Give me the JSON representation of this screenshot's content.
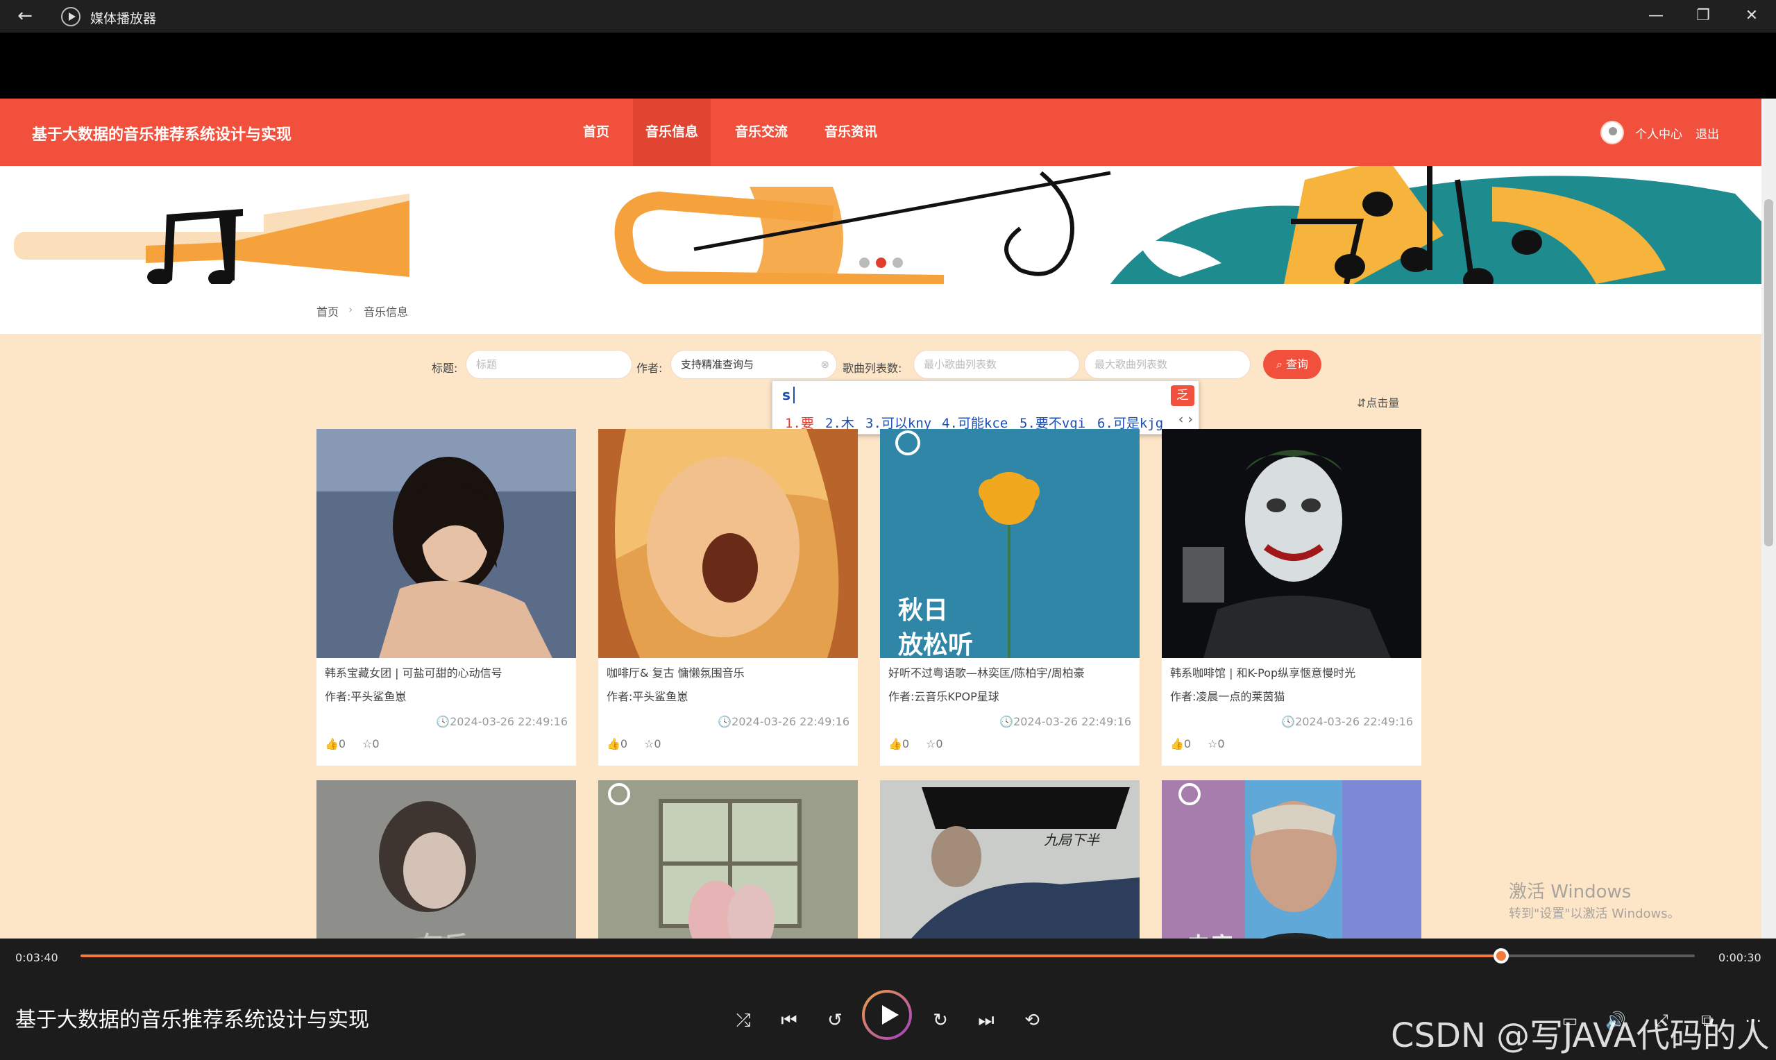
{
  "window": {
    "title": "媒体播放器",
    "back_icon": "←",
    "minimize_icon": "—",
    "restore_icon": "❐",
    "close_icon": "✕"
  },
  "site": {
    "brand": "基于大数据的音乐推荐系统设计与实现",
    "nav": [
      "首页",
      "音乐信息",
      "音乐交流",
      "音乐资讯"
    ],
    "active_nav": "音乐信息",
    "user_center": "个人中心",
    "logout": "退出",
    "accent_color": "#f0503c"
  },
  "breadcrumb": {
    "home": "首页",
    "separator": "›",
    "current": "音乐信息"
  },
  "search": {
    "title_label": "标题:",
    "title_placeholder": "标题",
    "author_label": "作者:",
    "author_value": "支持精准查询与",
    "count_label": "歌曲列表数:",
    "min_placeholder": "最小歌曲列表数",
    "max_placeholder": "最大歌曲列表数",
    "button": "查询",
    "sort_clicks": "点击量"
  },
  "ime": {
    "typed": "s",
    "candidates": [
      "1.要",
      "2.木",
      "3.可以kny",
      "4.可能kce",
      "5.要不vgi",
      "6.可是kjg"
    ],
    "arrows": "‹ ›",
    "logo": "乏"
  },
  "cards": [
    {
      "title": "韩系宝藏女团 | 可盐可甜的心动信号",
      "author": "作者:平头鲨鱼崽",
      "date": "🕓2024-03-26 22:49:16",
      "likes": "👍0",
      "favs": "☆0"
    },
    {
      "title": "咖啡厅& 复古 慵懒氛围音乐",
      "author": "作者:平头鲨鱼崽",
      "date": "🕓2024-03-26 22:49:16",
      "likes": "👍0",
      "favs": "☆0"
    },
    {
      "title": "好听不过粤语歌—林奕匡/陈柏宇/周柏豪",
      "author": "作者:云音乐KPOP星球",
      "date": "🕓2024-03-26 22:49:16",
      "likes": "👍0",
      "favs": "☆0",
      "img_text_1": "秋日",
      "img_text_2": "放松听"
    },
    {
      "title": "韩系咖啡馆 | 和K-Pop纵享惬意慢时光",
      "author": "作者:凌晨一点的莱茵猫",
      "date": "🕓2024-03-26 22:49:16",
      "likes": "👍0",
      "favs": "☆0"
    }
  ],
  "row2_texts": [
    "午后",
    "",
    "九局下半",
    "电音"
  ],
  "watermark": {
    "line1": "激活 Windows",
    "line2": "转到\"设置\"以激活 Windows。"
  },
  "player": {
    "elapsed": "0:03:40",
    "remaining": "0:00:30",
    "progress": 0.88,
    "song_title": "基于大数据的音乐推荐系统设计与实现",
    "shuffle_icon": "⤮",
    "prev_icon": "⏮",
    "rewind_icon": "↺",
    "forward_icon": "↻",
    "next_icon": "⏭",
    "repeat_icon": "⟲",
    "caption_icon": "▭",
    "volume_icon": "🔊",
    "fullscreen_icon": "⤢",
    "miniplayer_icon": "⧉",
    "more_icon": "⋯"
  },
  "overlay_watermark": "CSDN @写JAVA代码的人"
}
